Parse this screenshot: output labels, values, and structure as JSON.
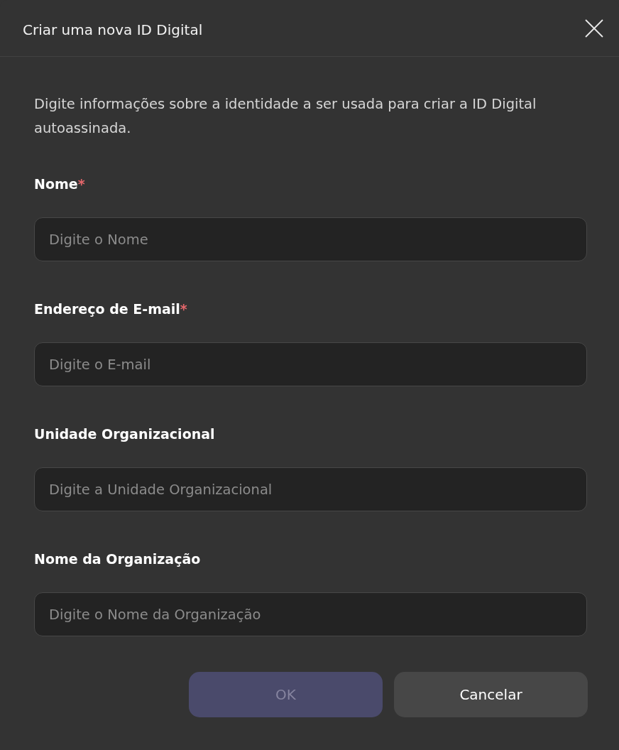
{
  "dialog": {
    "title": "Criar uma nova ID Digital",
    "description": "Digite informações sobre a identidade a ser usada para criar a ID Digital autoassinada."
  },
  "fields": [
    {
      "label": "Nome",
      "required": true,
      "required_mark": "*",
      "placeholder": "Digite o Nome"
    },
    {
      "label": "Endereço de E-mail",
      "required": true,
      "required_mark": "*",
      "placeholder": "Digite o E-mail"
    },
    {
      "label": "Unidade Organizacional",
      "required": false,
      "placeholder": "Digite a Unidade Organizacional"
    },
    {
      "label": "Nome da Organização",
      "required": false,
      "placeholder": "Digite o Nome da Organização"
    }
  ],
  "buttons": [
    {
      "label": "OK",
      "kind": "primary",
      "disabled": true
    },
    {
      "label": "Cancelar",
      "kind": "secondary",
      "disabled": false
    }
  ]
}
